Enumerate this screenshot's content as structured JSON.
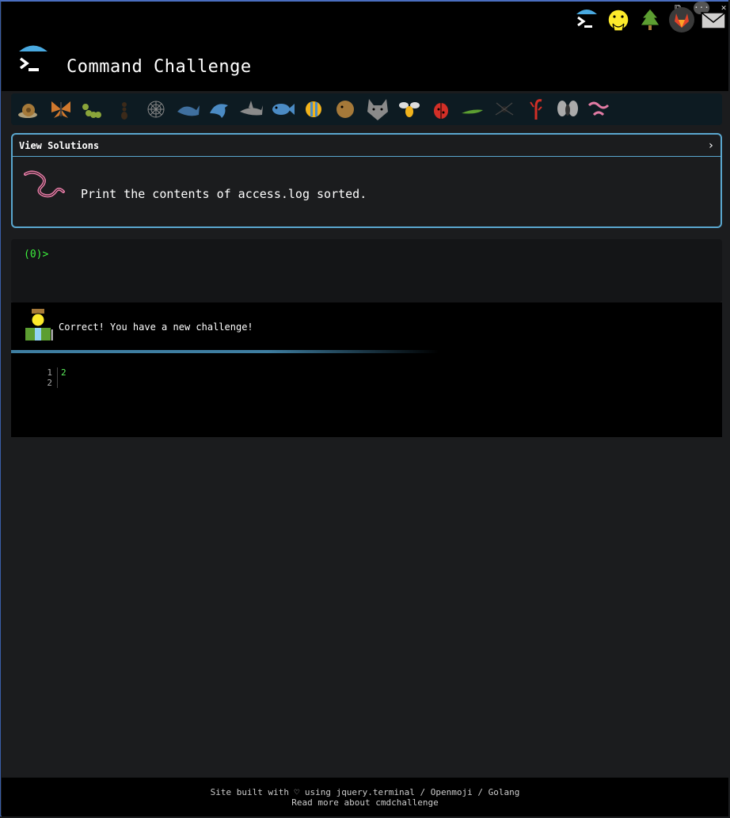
{
  "header": {
    "title": "Command Challenge",
    "icons": [
      "terminal-icon",
      "face-hand-over-mouth-icon",
      "evergreen-tree-icon",
      "gitlab-icon",
      "envelope-icon"
    ]
  },
  "window_controls": {
    "split": "⧉",
    "more": "···",
    "close": "✕"
  },
  "critters": [
    "snail",
    "butterfly",
    "caterpillar",
    "ant",
    "spiderweb",
    "whale",
    "dolphin",
    "shark",
    "fish",
    "tropical-fish",
    "blowfish",
    "wolf",
    "bee",
    "ladybug",
    "lizard",
    "spider",
    "scorpion",
    "fly",
    "worm"
  ],
  "challenge": {
    "solutions_label": "View Solutions",
    "chevron": "›",
    "task": "Print the contents of access.log sorted."
  },
  "terminal": {
    "prompt": "(0)>"
  },
  "result": {
    "message": "Correct! You have a new challenge!",
    "line_numbers": [
      "1",
      "2"
    ],
    "lines": [
      "2",
      ""
    ]
  },
  "footer": {
    "line1": "Site built with ♡ using jquery.terminal / Openmoji / Golang",
    "line2": "Read more about cmdchallenge"
  },
  "colors": {
    "accent": "#5aa7cf",
    "prompt": "#3cf03c",
    "background": "#1b1c1e"
  }
}
